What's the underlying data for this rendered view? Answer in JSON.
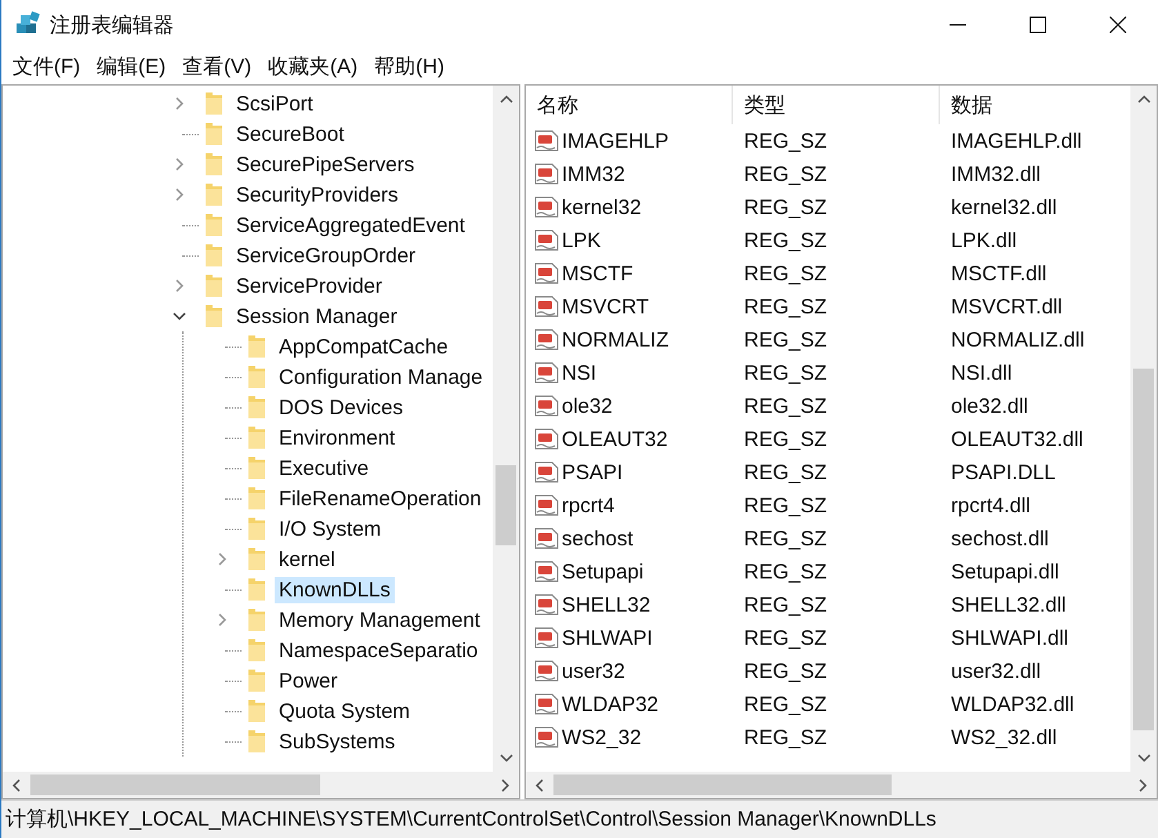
{
  "window": {
    "title": "注册表编辑器"
  },
  "menu": [
    "文件(F)",
    "编辑(E)",
    "查看(V)",
    "收藏夹(A)",
    "帮助(H)"
  ],
  "tree": [
    {
      "label": "ScsiPort",
      "expandable": true,
      "selected": false
    },
    {
      "label": "SecureBoot",
      "expandable": false,
      "selected": false
    },
    {
      "label": "SecurePipeServers",
      "expandable": true,
      "selected": false
    },
    {
      "label": "SecurityProviders",
      "expandable": true,
      "selected": false
    },
    {
      "label": "ServiceAggregatedEvent",
      "expandable": false,
      "selected": false
    },
    {
      "label": "ServiceGroupOrder",
      "expandable": false,
      "selected": false
    },
    {
      "label": "ServiceProvider",
      "expandable": true,
      "selected": false
    },
    {
      "label": "Session Manager",
      "expandable": true,
      "selected": false,
      "children": [
        {
          "label": "AppCompatCache",
          "expandable": false,
          "selected": false
        },
        {
          "label": "Configuration Manage",
          "expandable": false,
          "selected": false
        },
        {
          "label": "DOS Devices",
          "expandable": false,
          "selected": false
        },
        {
          "label": "Environment",
          "expandable": false,
          "selected": false
        },
        {
          "label": "Executive",
          "expandable": false,
          "selected": false
        },
        {
          "label": "FileRenameOperation",
          "expandable": false,
          "selected": false
        },
        {
          "label": "I/O System",
          "expandable": false,
          "selected": false
        },
        {
          "label": "kernel",
          "expandable": true,
          "selected": false
        },
        {
          "label": "KnownDLLs",
          "expandable": false,
          "selected": true
        },
        {
          "label": "Memory Management",
          "expandable": true,
          "selected": false
        },
        {
          "label": "NamespaceSeparatio",
          "expandable": false,
          "selected": false
        },
        {
          "label": "Power",
          "expandable": false,
          "selected": false
        },
        {
          "label": "Quota System",
          "expandable": false,
          "selected": false
        },
        {
          "label": "SubSystems",
          "expandable": false,
          "selected": false
        }
      ]
    }
  ],
  "table": {
    "columns": [
      "名称",
      "类型",
      "数据"
    ],
    "rows": [
      {
        "name": "IMAGEHLP",
        "type": "REG_SZ",
        "data": "IMAGEHLP.dll"
      },
      {
        "name": "IMM32",
        "type": "REG_SZ",
        "data": "IMM32.dll"
      },
      {
        "name": "kernel32",
        "type": "REG_SZ",
        "data": "kernel32.dll"
      },
      {
        "name": "LPK",
        "type": "REG_SZ",
        "data": "LPK.dll"
      },
      {
        "name": "MSCTF",
        "type": "REG_SZ",
        "data": "MSCTF.dll"
      },
      {
        "name": "MSVCRT",
        "type": "REG_SZ",
        "data": "MSVCRT.dll"
      },
      {
        "name": "NORMALIZ",
        "type": "REG_SZ",
        "data": "NORMALIZ.dll"
      },
      {
        "name": "NSI",
        "type": "REG_SZ",
        "data": "NSI.dll"
      },
      {
        "name": "ole32",
        "type": "REG_SZ",
        "data": "ole32.dll"
      },
      {
        "name": "OLEAUT32",
        "type": "REG_SZ",
        "data": "OLEAUT32.dll"
      },
      {
        "name": "PSAPI",
        "type": "REG_SZ",
        "data": "PSAPI.DLL"
      },
      {
        "name": "rpcrt4",
        "type": "REG_SZ",
        "data": "rpcrt4.dll"
      },
      {
        "name": "sechost",
        "type": "REG_SZ",
        "data": "sechost.dll"
      },
      {
        "name": "Setupapi",
        "type": "REG_SZ",
        "data": "Setupapi.dll"
      },
      {
        "name": "SHELL32",
        "type": "REG_SZ",
        "data": "SHELL32.dll"
      },
      {
        "name": "SHLWAPI",
        "type": "REG_SZ",
        "data": "SHLWAPI.dll"
      },
      {
        "name": "user32",
        "type": "REG_SZ",
        "data": "user32.dll"
      },
      {
        "name": "WLDAP32",
        "type": "REG_SZ",
        "data": "WLDAP32.dll"
      },
      {
        "name": "WS2_32",
        "type": "REG_SZ",
        "data": "WS2_32.dll"
      }
    ]
  },
  "status_bar": "计算机\\HKEY_LOCAL_MACHINE\\SYSTEM\\CurrentControlSet\\Control\\Session Manager\\KnownDLLs"
}
